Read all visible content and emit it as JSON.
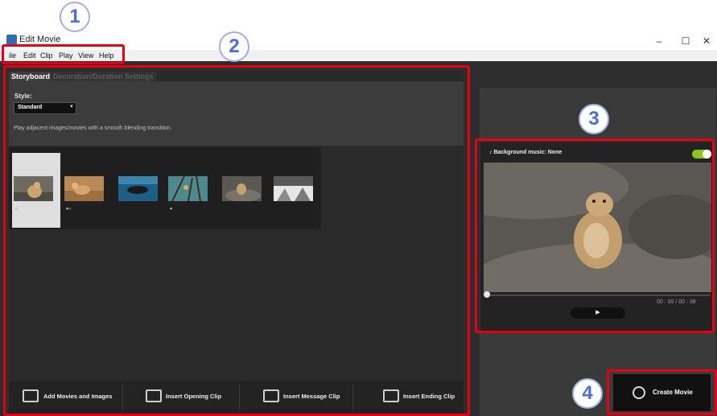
{
  "window": {
    "title": "Edit Movie",
    "minimize": "–",
    "maximize": "☐",
    "close": "✕"
  },
  "menu": [
    "ile",
    "Edit",
    "Clip",
    "Play",
    "View",
    "Help"
  ],
  "tabs": {
    "storyboard": "Storyboard",
    "decoration": "Decoration/Duration Settings"
  },
  "style": {
    "label": "Style:",
    "selected": "Standard",
    "description": "Play adjacent images/movies with a smooth blending transition."
  },
  "actions": {
    "add": "Add Movies and Images",
    "opening": "Insert Opening Clip",
    "message": "Insert Message Clip",
    "ending": "Insert Ending Clip"
  },
  "preview": {
    "bgm": "♪ Background music: None",
    "bgm_enabled": true,
    "time": "00 : 00  /  00 : 38",
    "play": "▶"
  },
  "create": {
    "label": "Create Movie"
  },
  "callouts": [
    "1",
    "2",
    "3",
    "4"
  ],
  "colors": {
    "highlight": "#e60012",
    "toggle_on": "#8dc21f",
    "badge_text": "#4a6fd8"
  }
}
